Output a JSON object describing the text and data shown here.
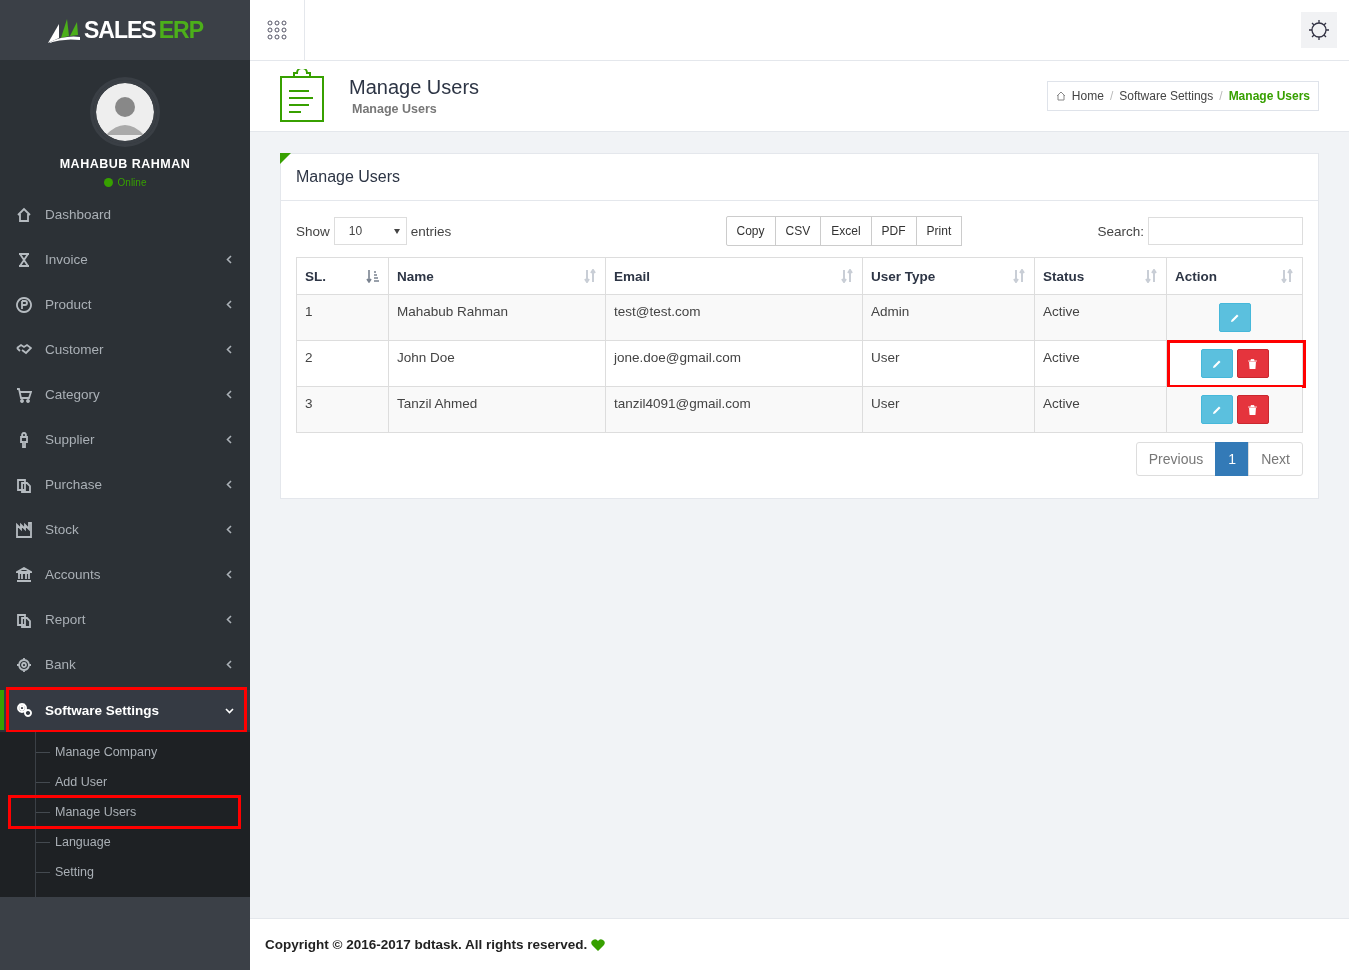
{
  "brand": {
    "name": "SALES",
    "accent": "ERP"
  },
  "user": {
    "name": "MAHABUB RAHMAN",
    "status": "Online"
  },
  "sidebar": {
    "items": [
      {
        "label": "Dashboard",
        "has_submenu": false,
        "expanded": false,
        "highlighted": false
      },
      {
        "label": "Invoice",
        "has_submenu": true,
        "expanded": false,
        "highlighted": false
      },
      {
        "label": "Product",
        "has_submenu": true,
        "expanded": false,
        "highlighted": false
      },
      {
        "label": "Customer",
        "has_submenu": true,
        "expanded": false,
        "highlighted": false
      },
      {
        "label": "Category",
        "has_submenu": true,
        "expanded": false,
        "highlighted": false
      },
      {
        "label": "Supplier",
        "has_submenu": true,
        "expanded": false,
        "highlighted": false
      },
      {
        "label": "Purchase",
        "has_submenu": true,
        "expanded": false,
        "highlighted": false
      },
      {
        "label": "Stock",
        "has_submenu": true,
        "expanded": false,
        "highlighted": false
      },
      {
        "label": "Accounts",
        "has_submenu": true,
        "expanded": false,
        "highlighted": false
      },
      {
        "label": "Report",
        "has_submenu": true,
        "expanded": false,
        "highlighted": false
      },
      {
        "label": "Bank",
        "has_submenu": true,
        "expanded": false,
        "highlighted": false
      },
      {
        "label": "Software Settings",
        "has_submenu": true,
        "expanded": true,
        "highlighted": true,
        "children": [
          {
            "label": "Manage Company",
            "highlighted": false
          },
          {
            "label": "Add User",
            "highlighted": false
          },
          {
            "label": "Manage Users",
            "highlighted": true
          },
          {
            "label": "Language",
            "highlighted": false
          },
          {
            "label": "Setting",
            "highlighted": false
          }
        ]
      }
    ]
  },
  "page_header": {
    "title": "Manage Users",
    "subtitle": "Manage Users"
  },
  "breadcrumb": [
    {
      "label": "Home",
      "current": false
    },
    {
      "label": "Software Settings",
      "current": false
    },
    {
      "label": "Manage Users",
      "current": true
    }
  ],
  "breadcrumb_separator": "/",
  "card": {
    "title": "Manage Users"
  },
  "length_control": {
    "before": "Show",
    "value": "10",
    "after": "entries"
  },
  "export_buttons": [
    "Copy",
    "CSV",
    "Excel",
    "PDF",
    "Print"
  ],
  "search": {
    "label": "Search:"
  },
  "table": {
    "columns": [
      {
        "label": "SL.",
        "sorted": true
      },
      {
        "label": "Name",
        "sorted": false
      },
      {
        "label": "Email",
        "sorted": false
      },
      {
        "label": "User Type",
        "sorted": false
      },
      {
        "label": "Status",
        "sorted": false
      },
      {
        "label": "Action",
        "sorted": false
      }
    ],
    "rows": [
      {
        "sl": "1",
        "name": "Mahabub Rahman",
        "email": "test@test.com",
        "user_type": "Admin",
        "status": "Active",
        "deletable": false,
        "highlighted": false
      },
      {
        "sl": "2",
        "name": "John Doe",
        "email": "jone.doe@gmail.com",
        "user_type": "User",
        "status": "Active",
        "deletable": true,
        "highlighted": true
      },
      {
        "sl": "3",
        "name": "Tanzil Ahmed",
        "email": "tanzil4091@gmail.com",
        "user_type": "User",
        "status": "Active",
        "deletable": true,
        "highlighted": false
      }
    ]
  },
  "pagination": {
    "previous": "Previous",
    "pages": [
      {
        "label": "1",
        "selected": true
      }
    ],
    "next": "Next"
  },
  "footer": {
    "text": "Copyright © 2016-2017 bdtask. All rights reserved."
  }
}
